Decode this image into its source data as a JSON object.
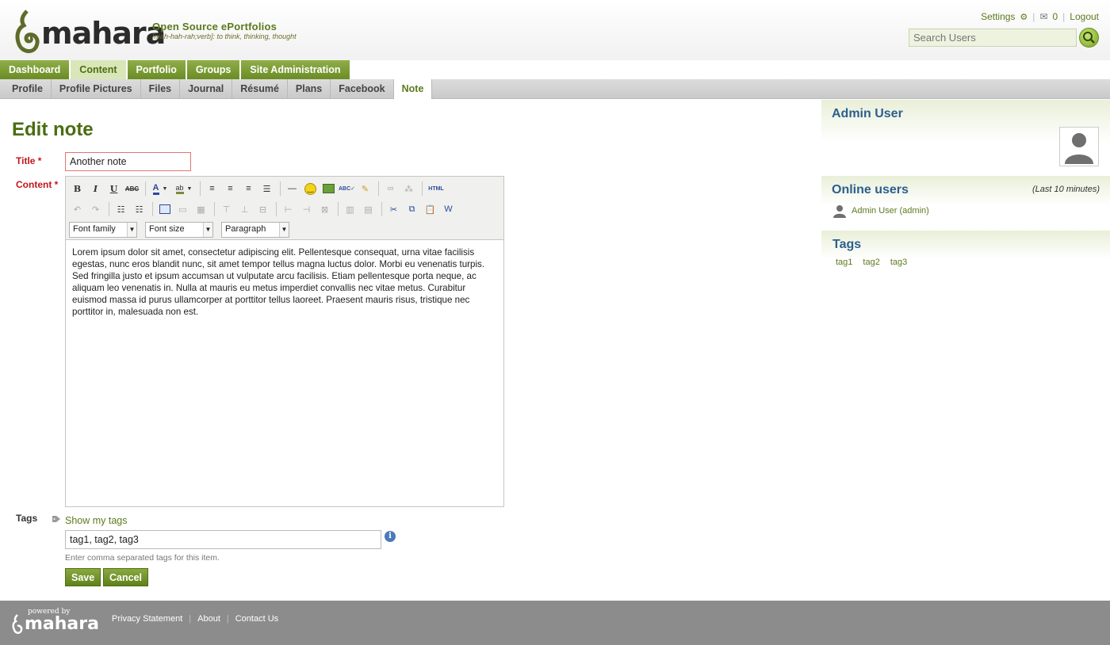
{
  "header": {
    "logo_text": "mahara",
    "tagline": "Open Source ePortfolios",
    "tagline_sub": "[mah-hah-rah;verb]: to think, thinking, thought",
    "settings_label": "Settings",
    "inbox_count": "0",
    "logout_label": "Logout",
    "search_placeholder": "Search Users"
  },
  "main_nav": [
    "Dashboard",
    "Content",
    "Portfolio",
    "Groups",
    "Site Administration"
  ],
  "sub_nav": [
    "Profile",
    "Profile Pictures",
    "Files",
    "Journal",
    "Résumé",
    "Plans",
    "Facebook",
    "Note"
  ],
  "page": {
    "title": "Edit note",
    "title_label": "Title",
    "content_label": "Content",
    "required_mark": "*",
    "title_value": "Another note",
    "font_family_select": "Font family",
    "font_size_select": "Font size",
    "format_select": "Paragraph",
    "html_button": "HTML",
    "content_text": "Lorem ipsum dolor sit amet, consectetur adipiscing elit. Pellentesque consequat, urna vitae facilisis egestas, nunc eros blandit nunc, sit amet tempor tellus magna luctus dolor. Morbi eu venenatis turpis. Sed fringilla justo et ipsum accumsan ut vulputate arcu facilisis. Etiam pellentesque porta neque, ac aliquam leo venenatis in. Nulla at mauris eu metus imperdiet convallis nec vitae metus. Curabitur euismod massa id purus ullamcorper at porttitor tellus laoreet. Praesent mauris risus, tristique nec porttitor in, malesuada non est.",
    "tags_label": "Tags",
    "show_my_tags": "Show my tags",
    "tags_value": "tag1, tag2, tag3",
    "tags_description": "Enter comma separated tags for this item.",
    "save_label": "Save",
    "cancel_label": "Cancel"
  },
  "sidebar": {
    "user_name": "Admin User",
    "online_title": "Online users",
    "online_note": "(Last 10 minutes)",
    "online_users": [
      "Admin User (admin)"
    ],
    "tags_title": "Tags",
    "tags": [
      "tag1",
      "tag2",
      "tag3"
    ]
  },
  "footer": {
    "powered_by": "powered by",
    "logo_text": "mahara",
    "links": [
      "Privacy Statement",
      "About",
      "Contact Us"
    ]
  },
  "colors": {
    "brand_green": "#6b8c25",
    "title_green": "#4a6d11",
    "sidebar_blue": "#2b5f8f",
    "footer_gray": "#8c8c8c"
  }
}
